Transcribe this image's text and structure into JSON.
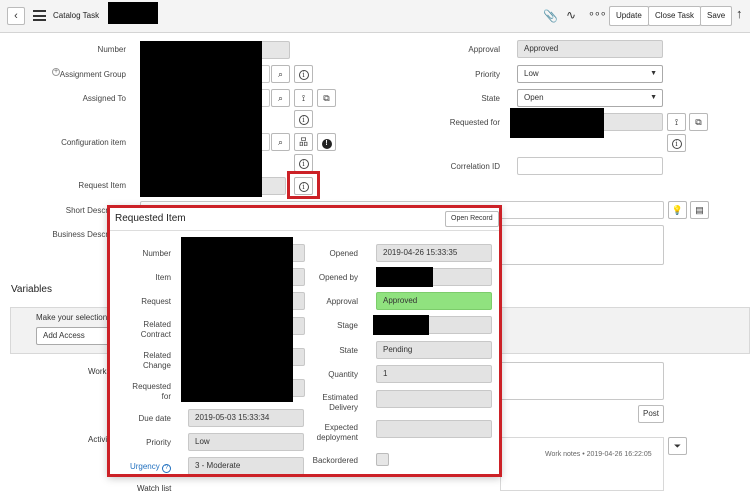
{
  "header": {
    "title": "Catalog Task",
    "buttons": {
      "update": "Update",
      "close_task": "Close Task",
      "save": "Save"
    }
  },
  "form": {
    "left_labels": {
      "number": "Number",
      "assignment_group": "Assignment Group",
      "assigned_to": "Assigned To",
      "configuration_item": "Configuration item",
      "request_item": "Request Item",
      "short_description": "Short Descr",
      "business_description": "Business Descr"
    },
    "right_labels": {
      "approval": "Approval",
      "priority": "Priority",
      "state": "State",
      "requested_for": "Requested for",
      "correlation_id": "Correlation ID"
    },
    "values": {
      "approval": "Approved",
      "priority": "Low",
      "state": "Open"
    }
  },
  "variables": {
    "title": "Variables",
    "selection_label": "Make your selection:",
    "selection_value": "Add Access"
  },
  "activity": {
    "work_label": "Work",
    "activity_label": "Activi",
    "post_label": "Post",
    "work_notes_entry": "Work notes  •  2019-04-26 16:22:05",
    "watch_list": "Watch list"
  },
  "popup": {
    "title": "Requested Item",
    "open_record": "Open Record",
    "left": {
      "number": "Number",
      "item": "Item",
      "request": "Request",
      "related_contract": "Related\nContract",
      "related_change": "Related\nChange",
      "requested_for": "Requested\nfor",
      "due_date": "Due date",
      "due_date_value": "2019-05-03 15:33:34",
      "priority": "Priority",
      "priority_value": "Low",
      "urgency": "Urgency",
      "urgency_value": "3 - Moderate"
    },
    "right": {
      "opened": "Opened",
      "opened_value": "2019-04-26 15:33:35",
      "opened_by": "Opened by",
      "approval": "Approval",
      "approval_value": "Approved",
      "stage": "Stage",
      "state": "State",
      "state_value": "Pending",
      "quantity": "Quantity",
      "quantity_value": "1",
      "estimated_delivery": "Estimated\nDelivery",
      "expected_deployment": "Expected\ndeployment",
      "backordered": "Backordered"
    }
  },
  "colors": {
    "highlight_red": "#cc2127",
    "approved_green": "#90e27f",
    "link_blue": "#1f6fbf"
  }
}
